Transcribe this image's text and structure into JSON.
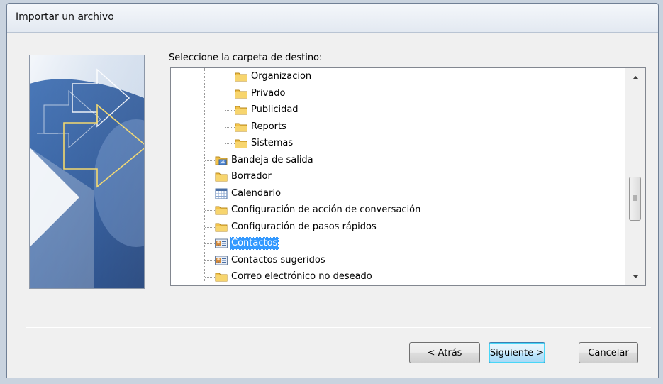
{
  "dialog": {
    "title": "Importar un archivo",
    "prompt": "Seleccione la carpeta de destino:",
    "buttons": {
      "back": "< Atrás",
      "next": "Siguiente >",
      "cancel": "Cancelar"
    }
  },
  "tree": {
    "selected": "Contactos",
    "items": [
      {
        "label": "Organizacion",
        "icon": "folder-icon",
        "level": 2
      },
      {
        "label": "Privado",
        "icon": "folder-icon",
        "level": 2
      },
      {
        "label": "Publicidad",
        "icon": "folder-icon",
        "level": 2
      },
      {
        "label": "Reports",
        "icon": "folder-icon",
        "level": 2
      },
      {
        "label": "Sistemas",
        "icon": "folder-icon",
        "level": 2
      },
      {
        "label": "Bandeja de salida",
        "icon": "outbox-folder-icon",
        "level": 1
      },
      {
        "label": "Borrador",
        "icon": "folder-icon",
        "level": 1
      },
      {
        "label": "Calendario",
        "icon": "calendar-icon",
        "level": 1
      },
      {
        "label": "Configuración de acción de conversación",
        "icon": "folder-icon",
        "level": 1
      },
      {
        "label": "Configuración de pasos rápidos",
        "icon": "folder-icon",
        "level": 1
      },
      {
        "label": "Contactos",
        "icon": "contacts-icon",
        "level": 1
      },
      {
        "label": "Contactos sugeridos",
        "icon": "contacts-icon",
        "level": 1
      },
      {
        "label": "Correo electrónico no deseado",
        "icon": "folder-icon",
        "level": 1
      }
    ]
  },
  "colors": {
    "selection": "#3399ff",
    "folder": "#f2c24a",
    "banner_blue": "#2f5c9e"
  }
}
